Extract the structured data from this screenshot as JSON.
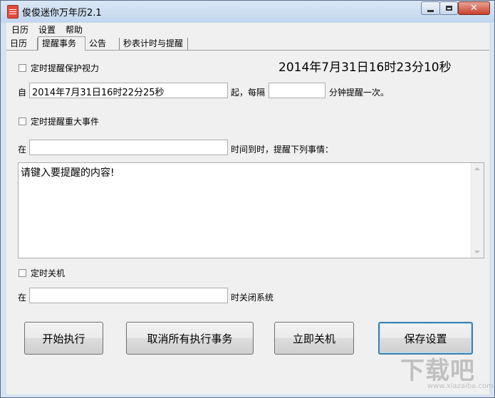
{
  "window": {
    "title": "俊俊迷你万年历2.1",
    "close_glyph": "✕"
  },
  "menu": [
    "日历",
    "设置",
    "帮助"
  ],
  "tabs": [
    "日历",
    "提醒事务",
    "公告",
    "秒表计时与提醒"
  ],
  "active_tab": "提醒事务",
  "clock": "2014年7月31日16时23分10秒",
  "eye": {
    "checkbox_label": "定时提醒保护视力",
    "checked": false,
    "from_label": "自",
    "from_value": "2014年7月31日16时22分25秒",
    "mid_label": "起，每隔",
    "interval_value": "",
    "suffix_label": "分钟提醒一次。"
  },
  "event": {
    "checkbox_label": "定时提醒重大事件",
    "checked": false,
    "at_label": "在",
    "time_value": "",
    "suffix_label": "时间到时，提醒下列事情：",
    "content": "请键入要提醒的内容!"
  },
  "shutdown": {
    "checkbox_label": "定时关机",
    "checked": false,
    "at_label": "在",
    "time_value": "",
    "suffix_label": "时关闭系统"
  },
  "buttons": {
    "start": "开始执行",
    "cancel_all": "取消所有执行事务",
    "shutdown_now": "立即关机",
    "save": "保存设置"
  },
  "watermark": {
    "main": "下载吧",
    "sub": "www.xiazaiba.com"
  },
  "colors": {
    "title_gradient": "#c2d6ee",
    "close_button": "#c7402a",
    "default_button_border": "#3c7fb1"
  },
  "icons": [
    "app-calendar-icon",
    "minimize-icon",
    "maximize-icon",
    "close-icon",
    "scroll-up-arrow-icon",
    "scroll-down-arrow-icon"
  ]
}
